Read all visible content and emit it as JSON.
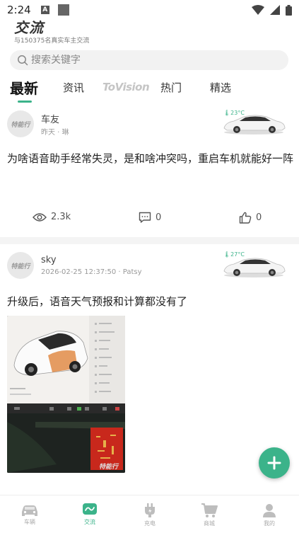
{
  "status_bar": {
    "time": "2:24",
    "a_badge": "A"
  },
  "header": {
    "title": "交流",
    "subtitle": "与150375名真实车主交流"
  },
  "search": {
    "placeholder": "搜索关键字"
  },
  "tabs": [
    {
      "label": "最新",
      "active": true
    },
    {
      "label": "资讯",
      "active": false
    },
    {
      "label": "ToVision",
      "active": false
    },
    {
      "label": "热门",
      "active": false
    },
    {
      "label": "精选",
      "active": false
    }
  ],
  "posts": [
    {
      "avatar_text": "特能行",
      "author": "车友",
      "meta": "昨天 · 琳",
      "temperature": "23°C",
      "text": "为啥语音助手经常失灵，是和啥冲突吗，重启车机就能好一阵",
      "views": "2.3k",
      "comments": "0",
      "likes": "0"
    },
    {
      "avatar_text": "特能行",
      "author": "sky",
      "meta": "2026-02-25 12:37:50 · Patsy",
      "temperature": "27°C",
      "text": "升级后，语音天气预报和计算都没有了",
      "image_watermark": "特能行"
    }
  ],
  "bottom_nav": [
    {
      "label": "车辆",
      "icon": "car-icon",
      "active": false
    },
    {
      "label": "交流",
      "icon": "chat-icon",
      "active": true
    },
    {
      "label": "充电",
      "icon": "charging-plug-icon",
      "active": false
    },
    {
      "label": "商城",
      "icon": "cart-icon",
      "active": false
    },
    {
      "label": "我的",
      "icon": "profile-icon",
      "active": false
    }
  ],
  "colors": {
    "accent": "#3bb38a",
    "text_primary": "#222222",
    "text_secondary": "#999999"
  }
}
